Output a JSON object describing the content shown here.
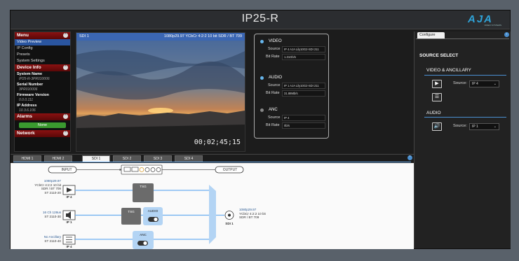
{
  "app": {
    "title": "IP25-R",
    "logo": "AJA",
    "logo_sub": "VIDEO SYSTEMS"
  },
  "menu": {
    "header": "Menu",
    "items": [
      {
        "label": "Video Preview",
        "active": true
      },
      {
        "label": "IP Config",
        "active": false
      },
      {
        "label": "Presets",
        "active": false
      },
      {
        "label": "System Settings",
        "active": false
      }
    ],
    "device_info": {
      "header": "Device Info",
      "fields": [
        {
          "label": "System Name",
          "value": "IP25-R-3PR010006"
        },
        {
          "label": "Serial Number",
          "value": "3PR010006"
        },
        {
          "label": "Firmware Version",
          "value": "0.0.0.111"
        },
        {
          "label": "IP Address",
          "value": "10.3.6.106"
        }
      ]
    },
    "alarms": {
      "header": "Alarms",
      "status": "None"
    },
    "network": {
      "header": "Network"
    }
  },
  "preview": {
    "source": "SDI 1",
    "format": "1080p29.97 YCbCr 4:2:2 10 bit SDR / BT 709",
    "timecode": "00;02;45;15"
  },
  "source_info": {
    "video": {
      "title": "VIDEO",
      "source_label": "Source",
      "source_value": "IP 4 AJA Lily10G2-SDI 211",
      "bitrate_label": "Bit Rate",
      "bitrate_value": "1.31Gb/s"
    },
    "audio": {
      "title": "AUDIO",
      "source_label": "Source",
      "source_value": "IP 1 AJA Lily10G2-SDI 211",
      "bitrate_label": "Bit Rate",
      "bitrate_value": "31.88Mb/s"
    },
    "anc": {
      "title": "ANC",
      "source_label": "Source",
      "source_value": "IP 4",
      "bitrate_label": "Bit Rate",
      "bitrate_value": "0b/s"
    }
  },
  "configure": {
    "tab": "Configure",
    "section_title": "SOURCE SELECT",
    "video_anc_title": "VIDEO & ANCILLARY",
    "video_source_label": "Source:",
    "video_source_value": "IP 4",
    "audio_title": "AUDIO",
    "audio_source_label": "Source:",
    "audio_source_value": "IP 1"
  },
  "tabs": [
    {
      "label": "HDMI 1",
      "active": false
    },
    {
      "label": "HDMI 2",
      "active": false
    },
    {
      "label": "SDI 1",
      "active": true
    },
    {
      "label": "SDI 2",
      "active": false
    },
    {
      "label": "SDI 3",
      "active": false
    },
    {
      "label": "SDI 4",
      "active": false
    }
  ],
  "diagram": {
    "input_label": "INPUT",
    "output_label": "OUTPUT",
    "video_in": {
      "format": "1080p29.97",
      "color": "YCbCr 4:2:2 10 bit",
      "range": "SDR / BT 709",
      "std": "ST 2110-20",
      "port": "IP 4"
    },
    "audio_in": {
      "format": "16 Ch 128us",
      "std": "ST 2110-30",
      "port": "IP 1"
    },
    "anc_in": {
      "format": "No Ancillary",
      "std": "ST 2110-40",
      "port": "IP 4"
    },
    "tsg_video": "TSG",
    "tsg_audio": "TSG",
    "audio_toggle": "AUDIO",
    "anc_toggle": "ANC",
    "output": {
      "format": "1080p29.97",
      "color": "YCbCr 4:2:2 10 bit",
      "range": "SDR / BT 709",
      "port": "SDI 1"
    }
  },
  "colors": {
    "accent": "#3b66b3",
    "menu_header": "#8a1111",
    "alarm_ok": "#3a9a2f",
    "line": "#6aaef0"
  }
}
